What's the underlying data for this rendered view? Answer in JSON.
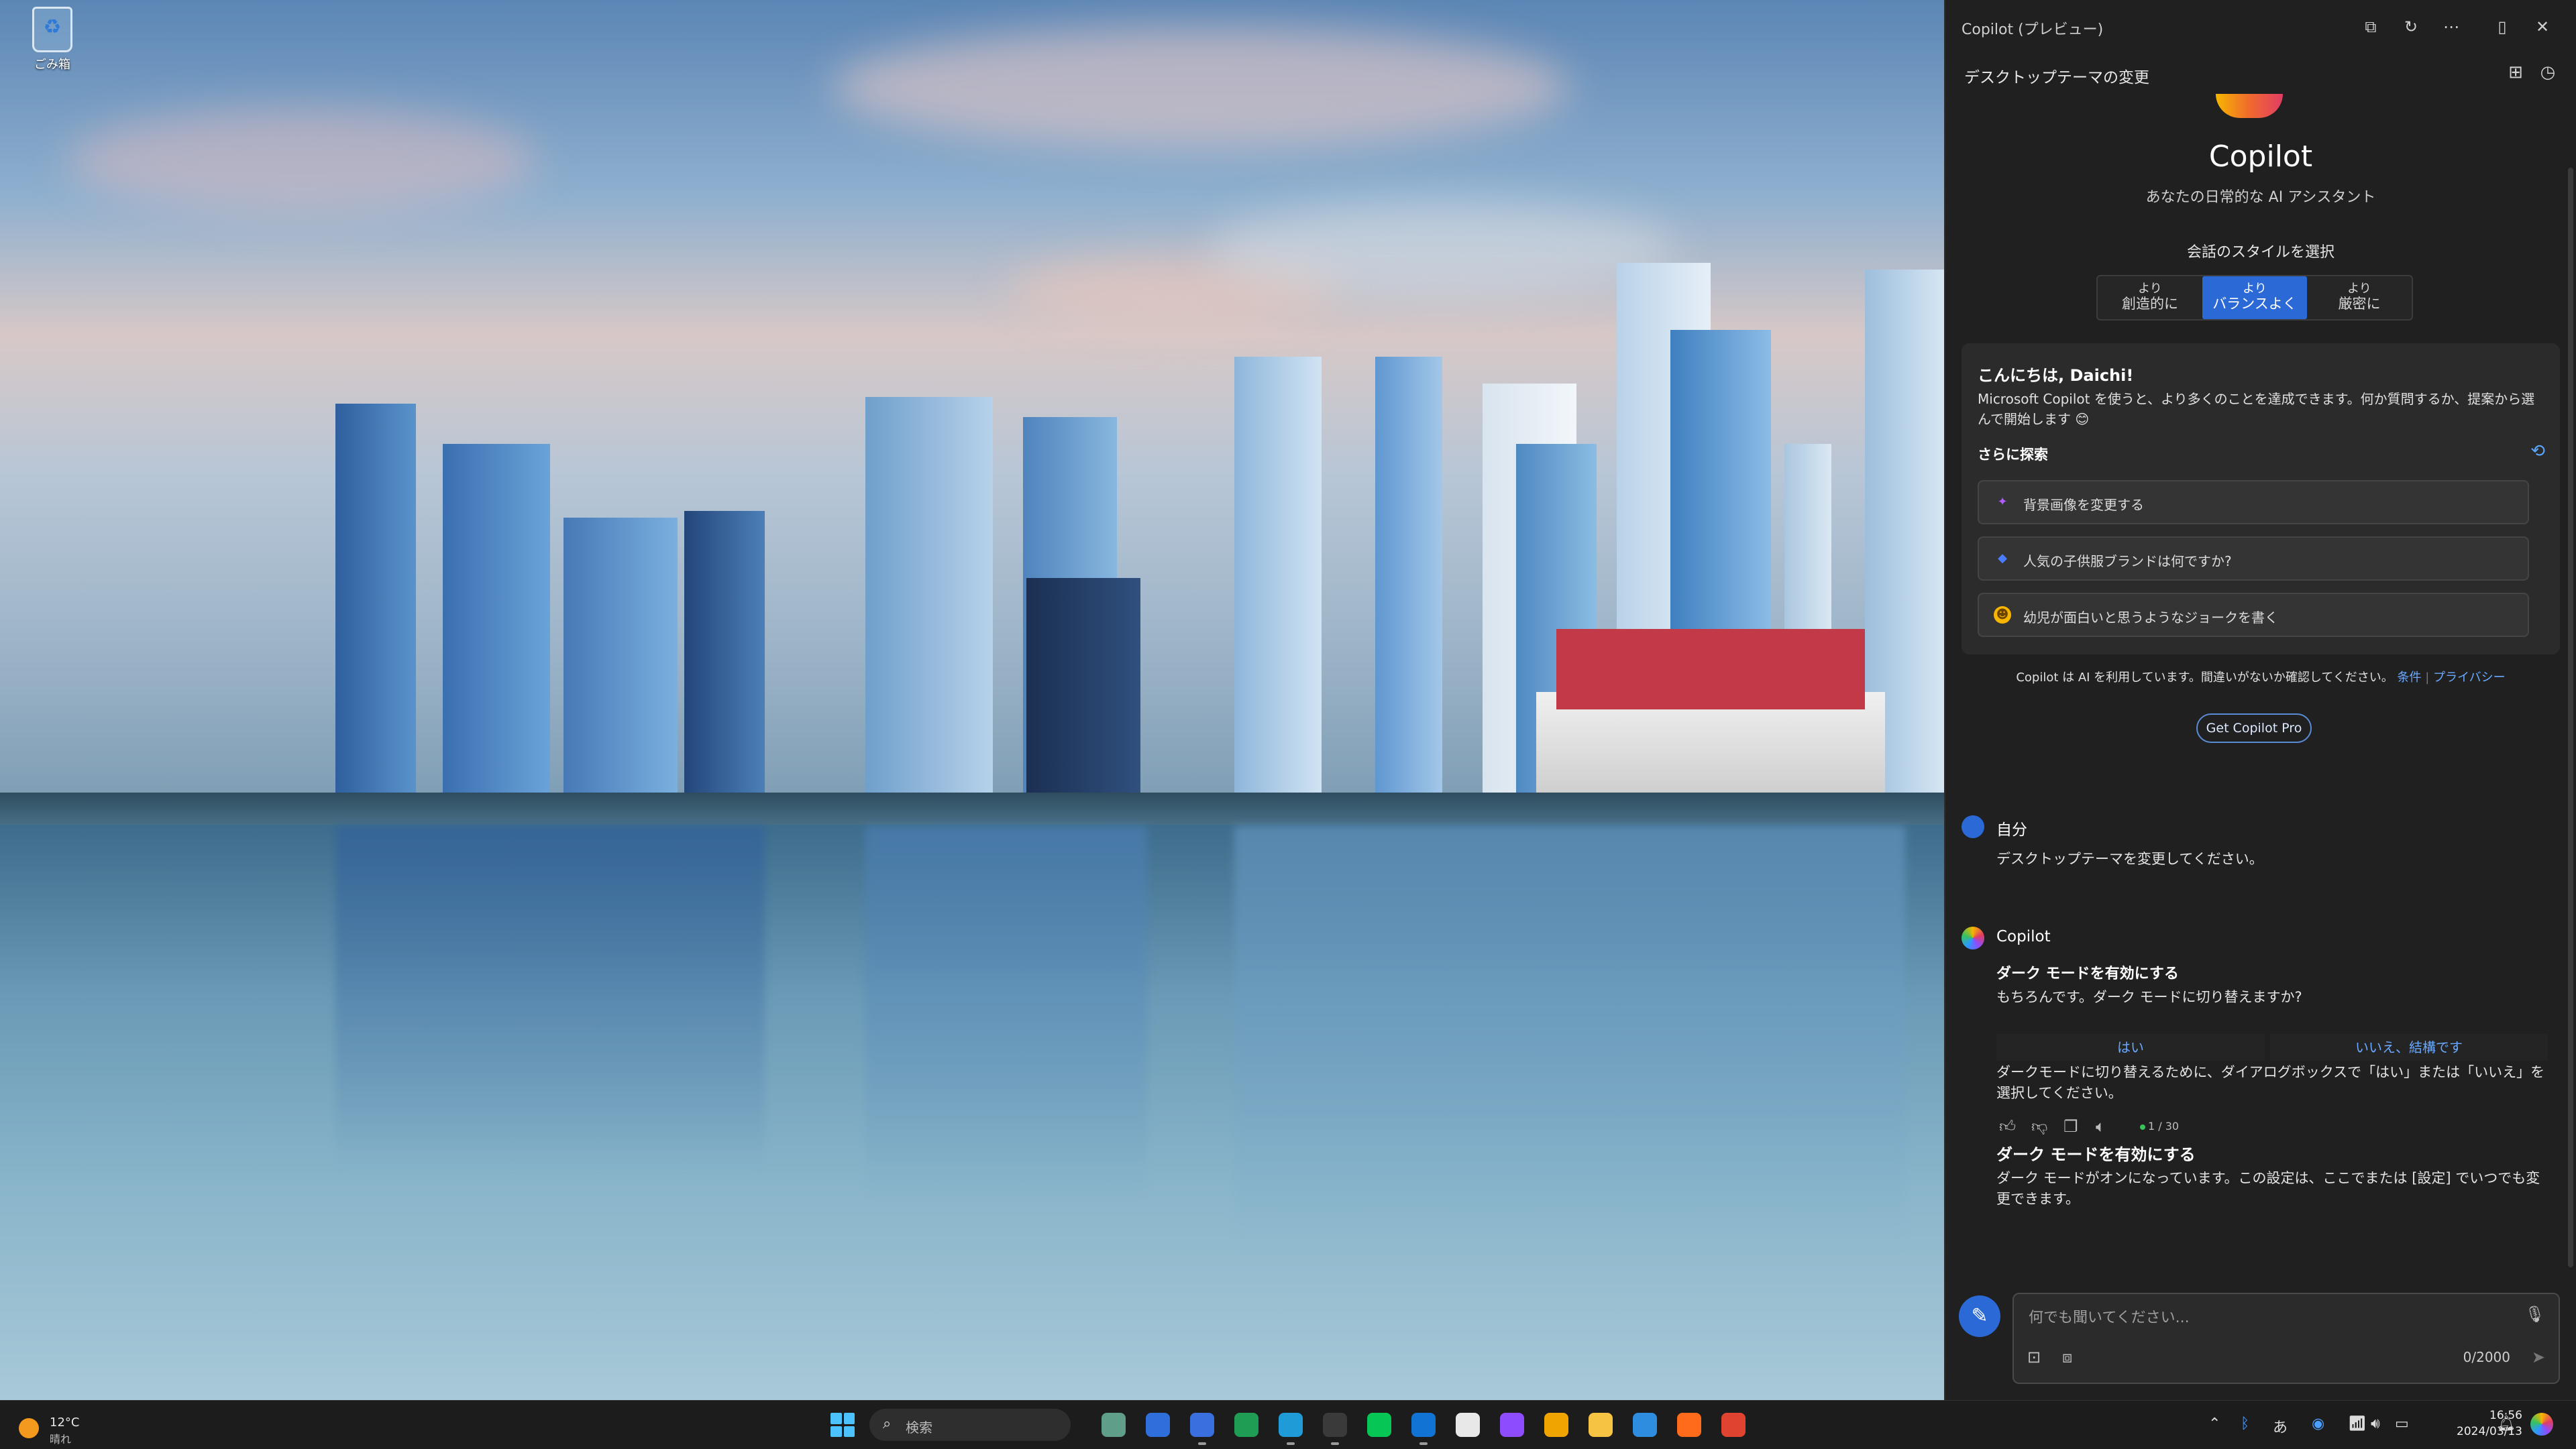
{
  "desktop": {
    "recycle_bin_label": "ごみ箱"
  },
  "copilot": {
    "window_title": "Copilot (プレビュー)",
    "window_buttons": [
      "open-external-icon",
      "refresh-icon",
      "more-icon",
      "dock-icon",
      "close-icon"
    ],
    "conversation_title": "デスクトップテーマの変更",
    "brand": "Copilot",
    "tagline": "あなたの日常的な AI アシスタント",
    "style_label": "会話のスタイルを選択",
    "styles": [
      {
        "line1": "より",
        "line2": "創造的に",
        "active": false
      },
      {
        "line1": "より",
        "line2": "バランスよく",
        "active": true
      },
      {
        "line1": "より",
        "line2": "厳密に",
        "active": false
      }
    ],
    "welcome": {
      "greeting": "こんにちは, Daichi!",
      "intro": "Microsoft Copilot を使うと、より多くのことを達成できます。何か質問するか、提案から選んで開始します 😊",
      "explore": "さらに探索",
      "suggestions": [
        {
          "icon": "sparkle-icon",
          "text": "背景画像を変更する",
          "color": "#b05cff"
        },
        {
          "icon": "pill-icon",
          "text": "人気の子供服ブランドは何ですか?",
          "color": "#4a7cff"
        },
        {
          "icon": "smile-icon",
          "text": "幼児が面白いと思うようなジョークを書く",
          "color": "#f7b500"
        }
      ]
    },
    "disclaimer": {
      "text": "Copilot は AI を利用しています。間違いがないか確認してください。",
      "terms": "条件",
      "privacy": "プライバシー"
    },
    "pro_button": "Get Copilot Pro",
    "user_message": {
      "name": "自分",
      "text": "デスクトップテーマを変更してください。"
    },
    "bot_message": {
      "name": "Copilot",
      "heading1": "ダーク モードを有効にする",
      "text1": "もちろんです。ダーク モードに切り替えますか?",
      "choice_yes": "はい",
      "choice_no": "いいえ、結構です",
      "text2": "ダークモードに切り替えるために、ダイアログボックスで「はい」または「いいえ」を選択してください。",
      "counter": "1 / 30",
      "heading2": "ダーク モードを有効にする",
      "text3": "ダーク モードがオンになっています。この設定は、ここでまたは [設定] でいつでも変更できます。"
    },
    "composer": {
      "placeholder": "何でも聞いてください...",
      "char_count": "0/2000"
    },
    "accent": "#2b6ad6"
  },
  "taskbar": {
    "weather_temp": "12°C",
    "weather_desc": "晴れ",
    "search_label": "検索",
    "time": "16:56",
    "date": "2024/03/13",
    "ime": "あ",
    "apps": [
      {
        "name": "chatgpt-app",
        "color": "#5f9f8a",
        "running": false
      },
      {
        "name": "files-app",
        "color": "#2e6fdc",
        "running": false
      },
      {
        "name": "docs-app",
        "color": "#3a6fe0",
        "running": true
      },
      {
        "name": "sheets-app",
        "color": "#1f9d55",
        "running": false
      },
      {
        "name": "edge-app",
        "color": "#1f9bd8",
        "running": true
      },
      {
        "name": "terminal-app",
        "color": "#3a3a3a",
        "running": true
      },
      {
        "name": "line-app",
        "color": "#06c755",
        "running": false
      },
      {
        "name": "outlook-app",
        "color": "#1173d4",
        "running": true
      },
      {
        "name": "slack-app",
        "color": "#e8e8e8",
        "running": false
      },
      {
        "name": "messenger-app",
        "color": "#8d4dff",
        "running": false
      },
      {
        "name": "mail-app",
        "color": "#f0a400",
        "running": false
      },
      {
        "name": "explorer-app",
        "color": "#f6c343",
        "running": false
      },
      {
        "name": "vscode-app",
        "color": "#2f8ddf",
        "running": false
      },
      {
        "name": "firefox-app",
        "color": "#ff6b1a",
        "running": false
      },
      {
        "name": "chrome-app",
        "color": "#e0432f",
        "running": false
      }
    ]
  }
}
